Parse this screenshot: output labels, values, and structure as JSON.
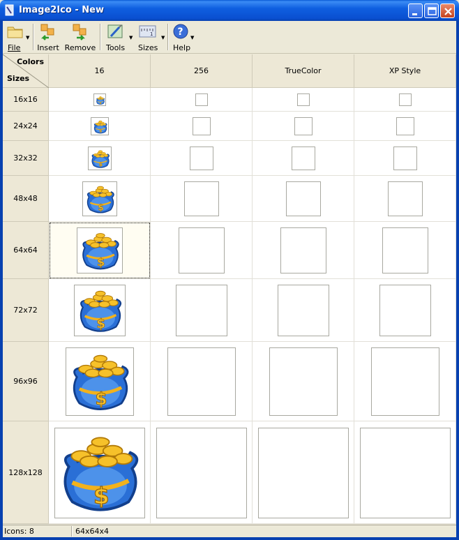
{
  "window": {
    "title": "Image2Ico - New"
  },
  "toolbar": {
    "file_label": "File",
    "insert_label": "Insert",
    "remove_label": "Remove",
    "tools_label": "Tools",
    "sizes_label": "Sizes",
    "help_label": "Help"
  },
  "grid": {
    "corner_top": "Colors",
    "corner_bottom": "Sizes",
    "columns": [
      "16",
      "256",
      "TrueColor",
      "XP Style"
    ],
    "rows": [
      "16x16",
      "24x24",
      "32x32",
      "48x48",
      "64x64",
      "72x72",
      "96x96",
      "128x128"
    ],
    "selected_row": "64x64",
    "selected_column": "16"
  },
  "statusbar": {
    "icons_count": "Icons: 8",
    "selection_info": "64x64x4"
  },
  "colors": {
    "titlebar": "#0a4fd0",
    "header_bg": "#ede8d6",
    "cell_border": "#a8a8a0"
  }
}
